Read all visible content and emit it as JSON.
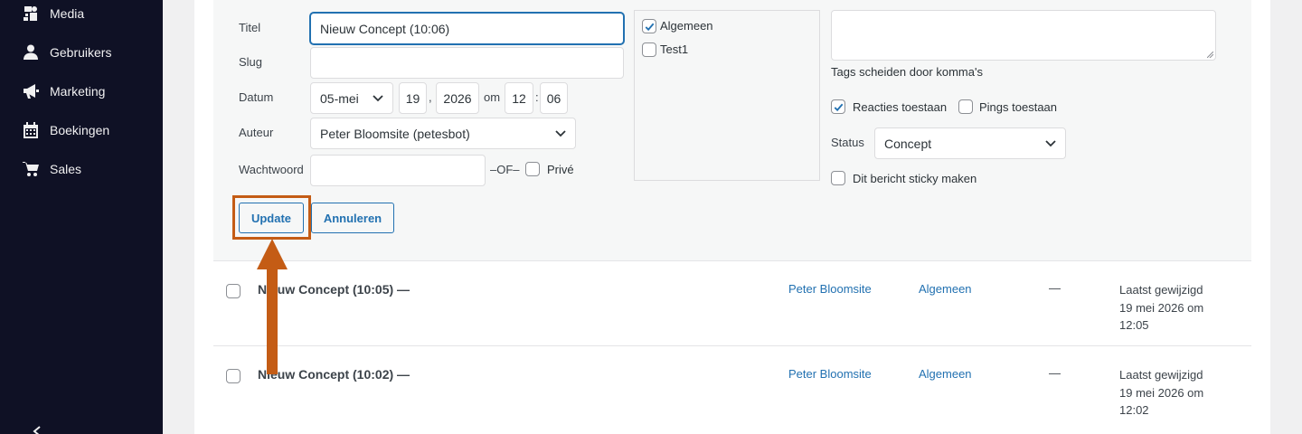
{
  "sidebar": {
    "items": [
      {
        "label": "Media",
        "icon": "media-icon"
      },
      {
        "label": "Gebruikers",
        "icon": "user-icon"
      },
      {
        "label": "Marketing",
        "icon": "megaphone-icon"
      },
      {
        "label": "Boekingen",
        "icon": "calendar-icon"
      },
      {
        "label": "Sales",
        "icon": "cart-icon"
      }
    ]
  },
  "quick_edit": {
    "title_label": "Titel",
    "title_value": "Nieuw Concept (10:06)",
    "slug_label": "Slug",
    "slug_value": "",
    "date_label": "Datum",
    "month_value": "05-mei",
    "day_value": "19",
    "comma": ",",
    "year_value": "2026",
    "at_label": "om",
    "hour_value": "12",
    "colon": ":",
    "minute_value": "06",
    "author_label": "Auteur",
    "author_value": "Peter Bloomsite (petesbot)",
    "password_label": "Wachtwoord",
    "password_value": "",
    "or_label": "–OF–",
    "private_label": "Privé",
    "categories": [
      {
        "label": "Algemeen",
        "checked": true
      },
      {
        "label": "Test1",
        "checked": false
      }
    ],
    "tags_value": "",
    "tags_hint": "Tags scheiden door komma's",
    "allow_comments_label": "Reacties toestaan",
    "allow_comments_checked": true,
    "allow_pings_label": "Pings toestaan",
    "allow_pings_checked": false,
    "status_label": "Status",
    "status_value": "Concept",
    "sticky_label": "Dit bericht sticky maken",
    "sticky_checked": false,
    "update_button": "Update",
    "cancel_button": "Annuleren"
  },
  "posts": [
    {
      "title": "Nieuw Concept (10:05) —",
      "author": "Peter Bloomsite",
      "category": "Algemeen",
      "tags": "—",
      "date_line1": "Laatst gewijzigd",
      "date_line2": "19 mei 2026 om",
      "date_line3": "12:05"
    },
    {
      "title": "Nieuw Concept (10:02) —",
      "author": "Peter Bloomsite",
      "category": "Algemeen",
      "tags": "—",
      "date_line1": "Laatst gewijzigd",
      "date_line2": "19 mei 2026 om",
      "date_line3": "12:02"
    }
  ],
  "colors": {
    "sidebar_bg": "#0f1125",
    "accent": "#2271b1",
    "annotation": "#c45c15"
  },
  "annotation": {
    "icon": "arrow-up-icon",
    "target": "update-button"
  }
}
